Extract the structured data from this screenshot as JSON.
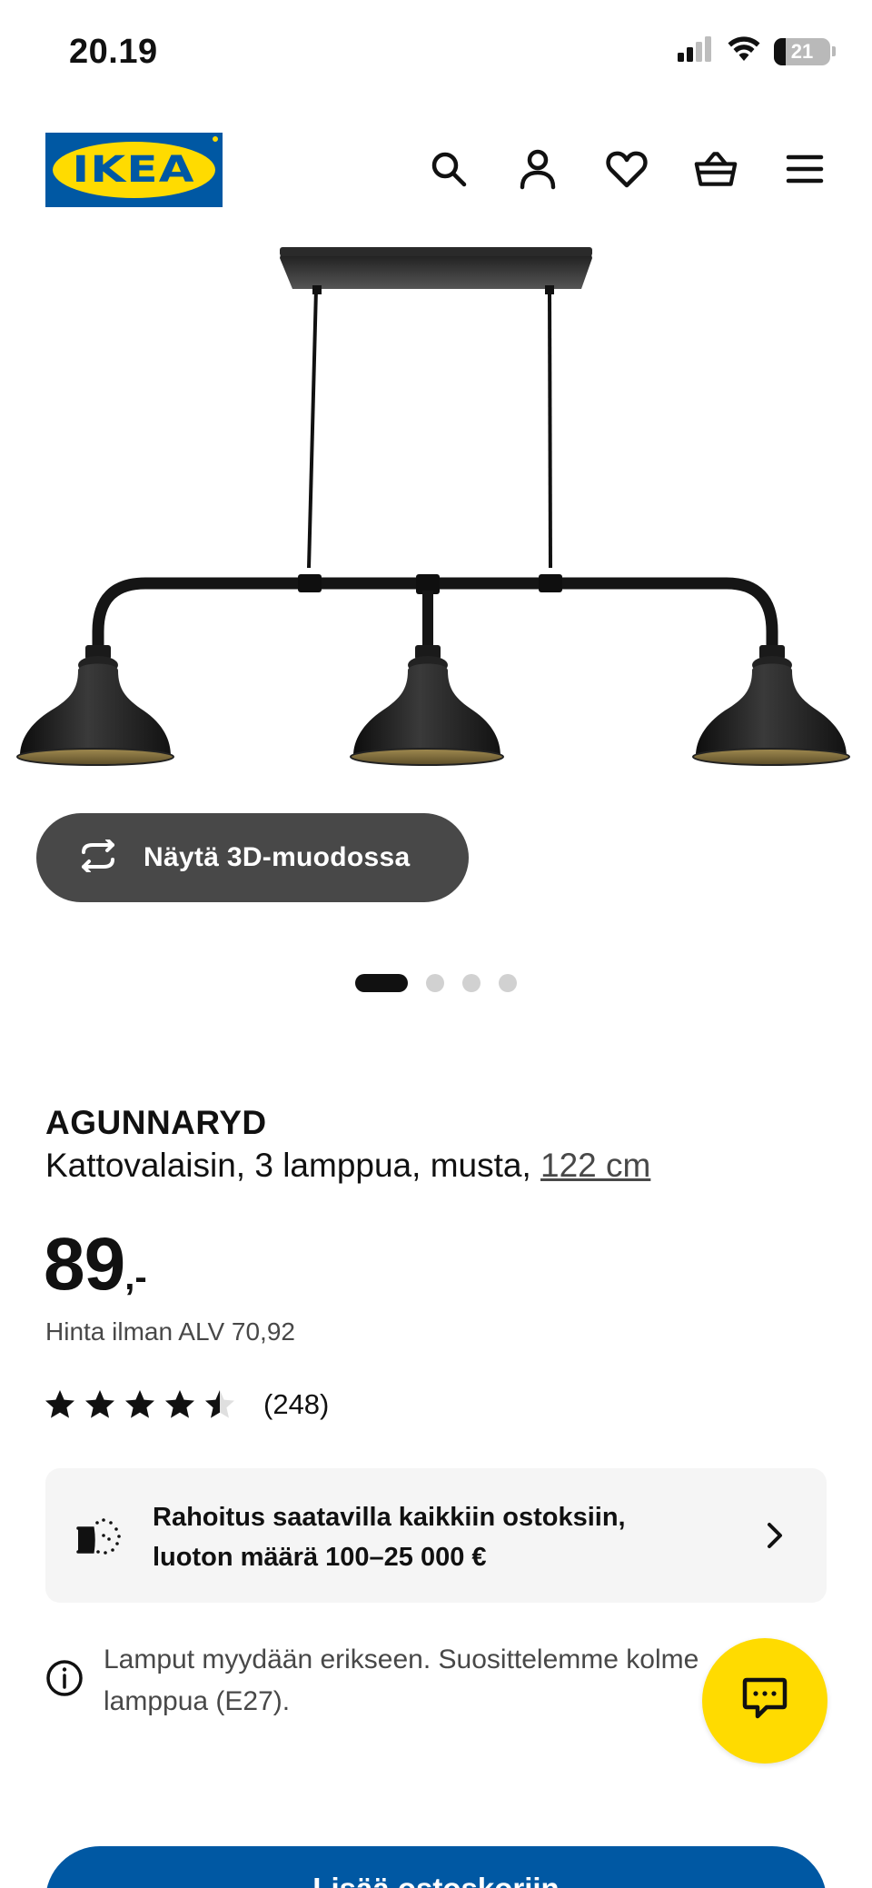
{
  "status_bar": {
    "time": "20.19",
    "battery_level": "21",
    "battery_percent": 21,
    "icons": [
      "cellular-signal-icon",
      "wifi-icon",
      "battery-icon"
    ]
  },
  "header": {
    "logo_text": "IKEA",
    "icons": [
      "search-icon",
      "account-icon",
      "favorites-heart-icon",
      "shopping-basket-icon",
      "menu-icon"
    ]
  },
  "view_3d_button": {
    "label": "Näytä 3D-muodossa",
    "icon": "rotate-3d-icon"
  },
  "carousel": {
    "total_slides": 4,
    "active_index": 0
  },
  "product": {
    "name": "AGUNNARYD",
    "description": "Kattovalaisin, 3 lamppua, musta, ",
    "size_link": "122 cm",
    "price": "89",
    "price_suffix": ",-",
    "price_vat_note": "Hinta ilman ALV 70,92",
    "rating_value": 4.5,
    "rating_max": 5,
    "rating_count": "(248)"
  },
  "finance": {
    "icon": "financing-icon",
    "text_line1": "Rahoitus saatavilla kaikkiin ostoksiin,",
    "text_line2": "luoton määrä 100–25 000 €"
  },
  "info_note": {
    "icon": "info-icon",
    "text": "Lamput myydään erikseen. Suosittelemme kolme lamppua (E27)."
  },
  "chat_button": {
    "icon": "chat-bubble-icon"
  },
  "add_to_cart": {
    "label": "Lisää ostoskoriin"
  },
  "colors": {
    "ikea_blue": "#0058a3",
    "ikea_yellow": "#ffdb00",
    "dark_button": "#484848",
    "card_background": "#f5f5f5"
  }
}
